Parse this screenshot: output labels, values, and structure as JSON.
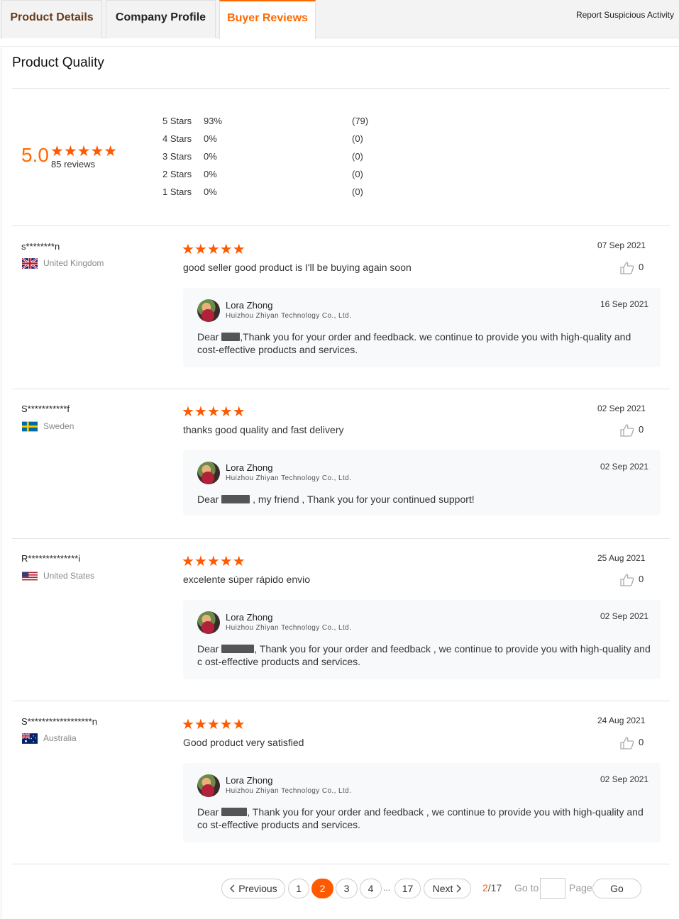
{
  "tabs": [
    {
      "label": "Product Details"
    },
    {
      "label": "Company Profile"
    },
    {
      "label": "Buyer Reviews"
    }
  ],
  "report_link": "Report Suspicious Activity",
  "section_title": "Product Quality",
  "summary": {
    "score": "5.0",
    "stars": "★★★★★",
    "reviews_label": "85 reviews",
    "distribution": [
      {
        "label": "5  Stars",
        "percent": "93%",
        "count": "(79)"
      },
      {
        "label": "4  Stars",
        "percent": "0%",
        "count": "(0)"
      },
      {
        "label": "3  Stars",
        "percent": "0%",
        "count": "(0)"
      },
      {
        "label": "2  Stars",
        "percent": "0%",
        "count": "(0)"
      },
      {
        "label": "1  Stars",
        "percent": "0%",
        "count": "(0)"
      }
    ]
  },
  "colors": {
    "accent": "#ff6a00",
    "star": "#ff5a00"
  },
  "reviews": [
    {
      "user": "s********n",
      "country": "United Kingdom",
      "flag_icon": "uk-flag-icon",
      "stars": "★★★★★",
      "text": "good seller good product is I'll be buying again soon",
      "date": "07 Sep 2021",
      "likes": "0",
      "reply": {
        "name": "Lora Zhong",
        "company": "Huizhou Zhiyan Technology Co., Ltd.",
        "date": "16 Sep 2021",
        "prefix": "Dear ",
        "text": ",Thank you for your order and feedback.  we continue to provide you with high-quality and cost-effective products and services."
      }
    },
    {
      "user": "S***********f",
      "country": "Sweden",
      "flag_icon": "sweden-flag-icon",
      "stars": "★★★★★",
      "text": "thanks good quality and fast delivery",
      "date": "02 Sep 2021",
      "likes": "0",
      "reply": {
        "name": "Lora Zhong",
        "company": "Huizhou Zhiyan Technology Co., Ltd.",
        "date": "02 Sep 2021",
        "prefix": "Dear ",
        "text": " , my friend , Thank you for your continued support!"
      }
    },
    {
      "user": "R**************i",
      "country": "United States",
      "flag_icon": "us-flag-icon",
      "stars": "★★★★★",
      "text": "excelente súper rápido envio",
      "date": "25 Aug 2021",
      "likes": "0",
      "reply": {
        "name": "Lora Zhong",
        "company": "Huizhou Zhiyan Technology Co., Ltd.",
        "date": "02 Sep 2021",
        "prefix": "Dear ",
        "text": ", Thank you for your order and feedback , we continue to provide you with high-quality and c ost-effective products and services."
      }
    },
    {
      "user": "S******************n",
      "country": "Australia",
      "flag_icon": "australia-flag-icon",
      "stars": "★★★★★",
      "text": "Good product very satisfied",
      "date": "24 Aug 2021",
      "likes": "0",
      "reply": {
        "name": "Lora Zhong",
        "company": "Huizhou Zhiyan Technology Co., Ltd.",
        "date": "02 Sep 2021",
        "prefix": "Dear ",
        "text": ", Thank you for your order and feedback , we continue to provide you with high-quality and co st-effective products and services."
      }
    }
  ],
  "pagination": {
    "previous": "Previous",
    "next": "Next",
    "pages": [
      "1",
      "2",
      "3",
      "4",
      "17"
    ],
    "ellipsis": "...",
    "current": "2",
    "total": "/17",
    "goto_label": "Go to",
    "goto_value": "",
    "page_label": "Page",
    "go": "Go"
  }
}
